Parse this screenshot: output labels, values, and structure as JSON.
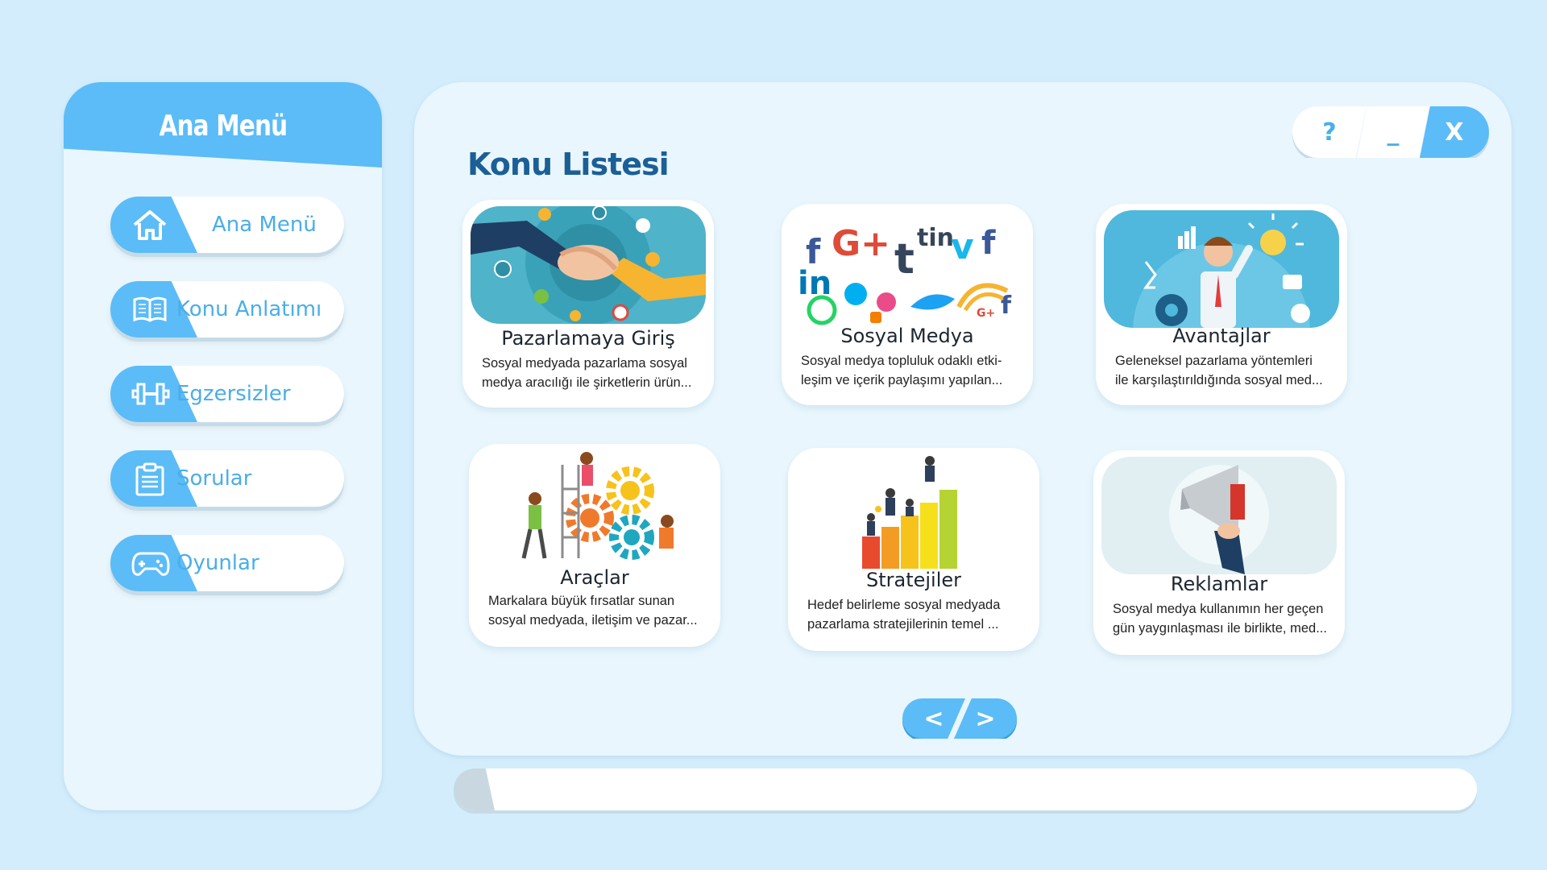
{
  "sidebar": {
    "title": "Ana Menü",
    "items": [
      {
        "label": "Ana Menü",
        "icon": "home-icon"
      },
      {
        "label": "Konu Anlatımı",
        "icon": "book-icon"
      },
      {
        "label": "Egzersizler",
        "icon": "dumbbell-icon"
      },
      {
        "label": "Sorular",
        "icon": "clipboard-icon"
      },
      {
        "label": "Oyunlar",
        "icon": "gamepad-icon"
      }
    ]
  },
  "window_controls": {
    "help": "?",
    "minimize": "_",
    "close": "X"
  },
  "main": {
    "title": "Konu Listesi",
    "cards": [
      {
        "title": "Pazarlamaya Giriş",
        "desc": "Sosyal medyada pazarlama sosyal\nmedya aracılığı ile şirketlerin ürün...",
        "image": "handshake-illustration"
      },
      {
        "title": "Sosyal Medya",
        "desc": "Sosyal medya topluluk odaklı etki-\nleşim ve içerik paylaşımı yapılan...",
        "image": "social-logos-illustration"
      },
      {
        "title": "Avantajlar",
        "desc": "Geleneksel pazarlama yöntemleri\nile karşılaştırıldığında sosyal med...",
        "image": "businessman-idea-illustration"
      },
      {
        "title": "Araçlar",
        "desc": "Markalara büyük fırsatlar sunan\nsosyal medyada, iletişim ve pazar...",
        "image": "gears-team-illustration"
      },
      {
        "title": "Stratejiler",
        "desc": "Hedef belirleme sosyal medyada\npazarlama stratejilerinin temel ...",
        "image": "growth-bars-illustration"
      },
      {
        "title": "Reklamlar",
        "desc": "Sosyal medya kullanımın her geçen\ngün yaygınlaşması ile birlikte, med...",
        "image": "megaphone-illustration"
      }
    ]
  },
  "pager": {
    "prev": "<",
    "next": ">"
  },
  "progress": {
    "value_fraction": 0.04
  },
  "colors": {
    "background": "#d3edfc",
    "accent": "#5bbcf7",
    "panel": "#e9f6fd",
    "title": "#1b5f96"
  }
}
